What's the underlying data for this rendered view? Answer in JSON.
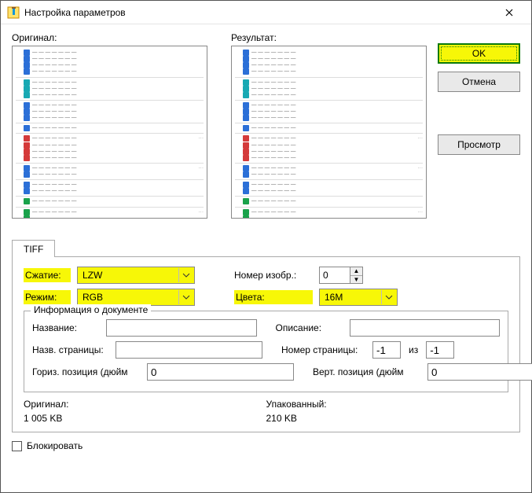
{
  "window": {
    "title": "Настройка параметров"
  },
  "previews": {
    "original_label": "Оригинал:",
    "result_label": "Результат:"
  },
  "side": {
    "ok": "OK",
    "cancel": "Отмена",
    "preview": "Просмотр"
  },
  "tabs": {
    "tiff": "TIFF"
  },
  "tiff": {
    "compression_label": "Сжатие:",
    "compression_value": "LZW",
    "mode_label": "Режим:",
    "mode_value": "RGB",
    "image_no_label": "Номер изобр.:",
    "image_no_value": "0",
    "colors_label": "Цвета:",
    "colors_value": "16M"
  },
  "docinfo": {
    "legend": "Информация о документе",
    "title_label": "Название:",
    "title_value": "",
    "desc_label": "Описание:",
    "desc_value": "",
    "page_name_label": "Назв. страницы:",
    "page_name_value": "",
    "page_no_label": "Номер страницы:",
    "page_no_value": "-1",
    "of_label": "из",
    "page_total_value": "-1",
    "hpos_label": "Гориз. позиция (дюйм",
    "hpos_value": "0",
    "vpos_label": "Верт. позиция (дюйм",
    "vpos_value": "0"
  },
  "sizes": {
    "original_label": "Оригинал:",
    "original_value": "1 005 KB",
    "packed_label": "Упакованный:",
    "packed_value": "210 KB"
  },
  "lock_label": "Блокировать"
}
